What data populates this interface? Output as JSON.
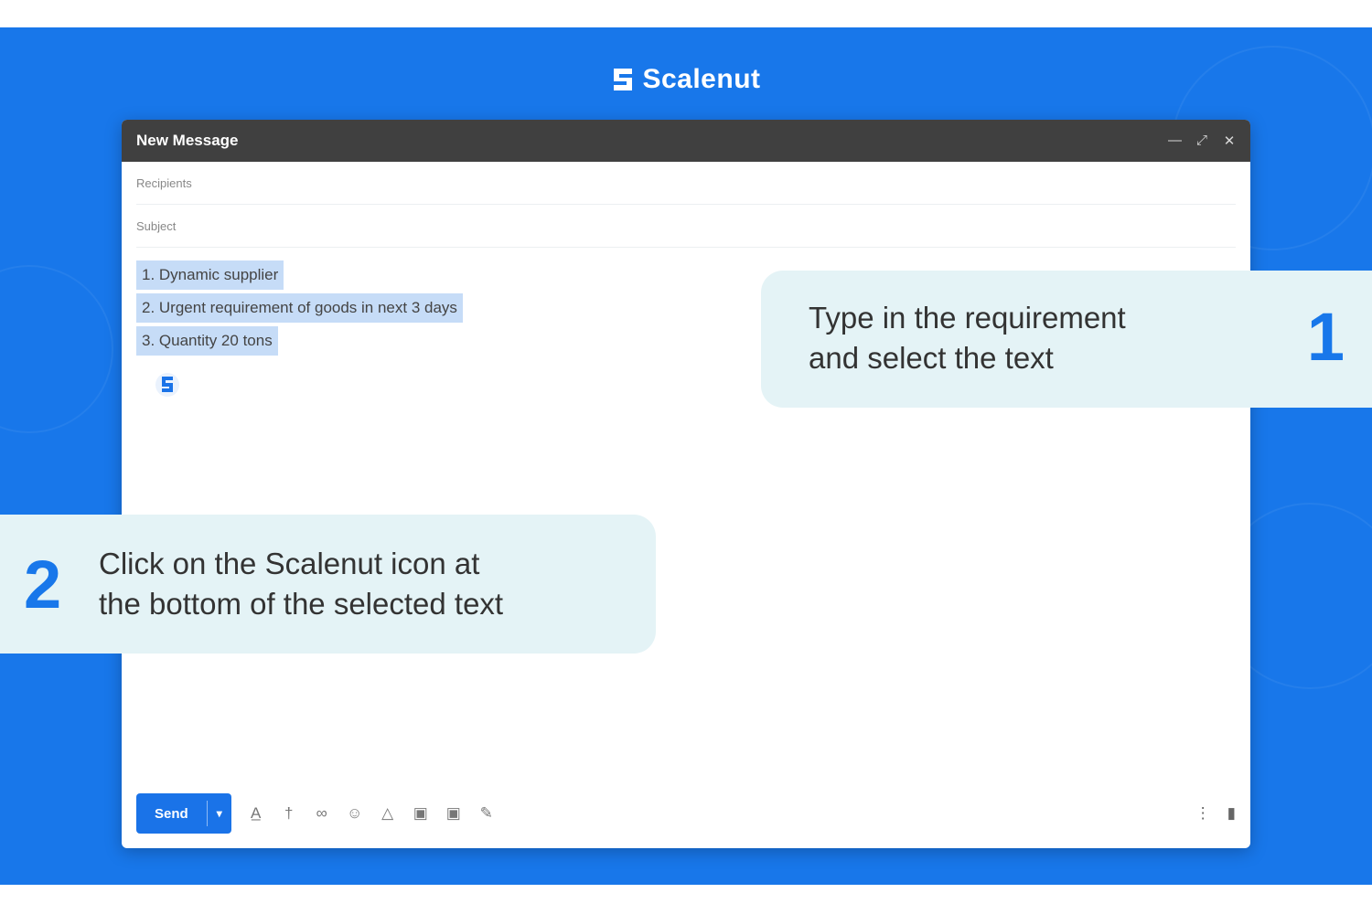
{
  "brand": {
    "name": "Scalenut"
  },
  "window": {
    "title": "New Message",
    "controls": [
      "minimize-icon",
      "expand-icon",
      "close-icon"
    ]
  },
  "compose": {
    "recipients_placeholder": "Recipients",
    "subject_placeholder": "Subject",
    "body_lines": [
      "1. Dynamic supplier",
      "2. Urgent requirement of goods in next 3 days",
      "3. Quantity 20 tons"
    ]
  },
  "toolbar": {
    "send_label": "Send",
    "send_dropdown_icon": "chevron-down-icon",
    "icons": [
      "text-format-icon",
      "attach-icon",
      "link-icon",
      "emoji-icon",
      "drive-icon",
      "image-icon",
      "lock-icon",
      "pen-icon"
    ],
    "right_icons": [
      "more-options-icon",
      "trash-icon"
    ]
  },
  "callouts": [
    {
      "number": "1",
      "lines": [
        "Type in the requirement",
        "and select the text"
      ]
    },
    {
      "number": "2",
      "lines": [
        "Click on the Scalenut icon at",
        "the bottom of the selected text"
      ]
    }
  ],
  "colors": {
    "background": "#1877ea",
    "callout": "#e4f3f6",
    "highlight": "#c6dcf7",
    "send": "#1a73e8",
    "titlebar": "#404040"
  }
}
